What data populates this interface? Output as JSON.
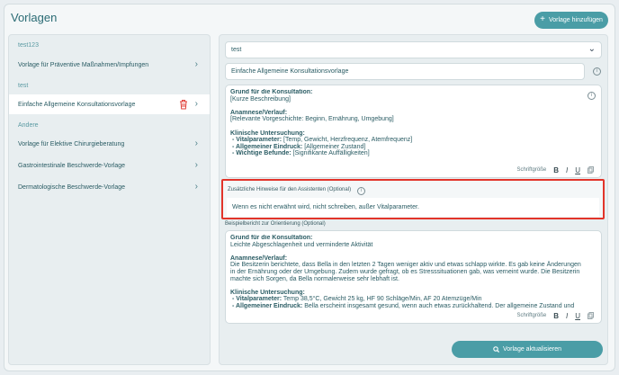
{
  "page": {
    "title": "Vorlagen",
    "add_button": "Vorlage hinzufügen"
  },
  "sidebar": {
    "groups": [
      {
        "title": "test123",
        "items": [
          "Vorlage für Präventive Maßnahmen/Impfungen"
        ]
      },
      {
        "title": "test",
        "items": [
          "Einfache Allgemeine Konsultationsvorlage"
        ]
      },
      {
        "title": "Andere",
        "items": [
          "Vorlage für Elektive Chirurgieberatung",
          "Gastrointestinale Beschwerde-Vorlage",
          "Dermatologische Beschwerde-Vorlage"
        ]
      }
    ],
    "active_item": "Einfache Allgemeine Konsultationsvorlage"
  },
  "form": {
    "category_select": "test",
    "template_name": "Einfache Allgemeine Konsultationsvorlage",
    "template_lines": [
      {
        "bold": "Grund für die Konsultation:",
        "text": ""
      },
      {
        "bold": "",
        "text": "[Kurze Beschreibung]"
      },
      {
        "bold": "",
        "text": ""
      },
      {
        "bold": "Anamnese/Verlauf:",
        "text": ""
      },
      {
        "bold": "",
        "text": "[Relevante Vorgeschichte: Beginn, Ernährung, Umgebung]"
      },
      {
        "bold": "",
        "text": ""
      },
      {
        "bold": "Klinische Untersuchung:",
        "text": ""
      },
      {
        "bold": " - Vitalparameter:",
        "text": " [Temp, Gewicht, Herzfrequenz, Atemfrequenz]"
      },
      {
        "bold": " - Allgemeiner Eindruck:",
        "text": " [Allgemeiner Zustand]"
      },
      {
        "bold": " - Wichtige Befunde:",
        "text": " [Signifikante Auffälligkeiten]"
      }
    ],
    "toolbar": {
      "size": "Schriftgröße",
      "bold": "B",
      "italic": "I",
      "underline": "U"
    },
    "hint_label": "Zusätzliche Hinweise für den Assistenten (Optional)",
    "hint_value": "Wenn es nicht erwähnt wird, nicht schreiben, außer Vitalparameter.",
    "example_label": "Beispielbericht zur Orientierung (Optional)",
    "example_lines": [
      {
        "bold": "Grund für die Konsultation:",
        "text": ""
      },
      {
        "bold": "",
        "text": "Leichte Abgeschlagenheit und verminderte Aktivität"
      },
      {
        "bold": "",
        "text": ""
      },
      {
        "bold": "Anamnese/Verlauf:",
        "text": ""
      },
      {
        "bold": "",
        "text": "Die Besitzerin berichtete, dass Bella in den letzten 2 Tagen weniger aktiv und etwas schlapp wirkte. Es gab keine Änderungen in der Ernährung oder der Umgebung. Zudem wurde gefragt, ob es Stresssituationen gab, was verneint wurde. Die Besitzerin machte sich Sorgen, da Bella normalerweise sehr lebhaft ist."
      },
      {
        "bold": "",
        "text": ""
      },
      {
        "bold": "Klinische Untersuchung:",
        "text": ""
      },
      {
        "bold": " - Vitalparameter:",
        "text": " Temp 38,5°C, Gewicht 25 kg, HF 90 Schläge/Min, AF 20 Atemzüge/Min"
      },
      {
        "bold": " - Allgemeiner Eindruck:",
        "text": " Bella erscheint insgesamt gesund, wenn auch etwas zurückhaltend. Der allgemeine Zustand und"
      }
    ],
    "update_button": "Vorlage aktualisieren"
  },
  "colors": {
    "accent": "#4a9da6",
    "highlight": "#e2342a",
    "text": "#2a5c64"
  }
}
